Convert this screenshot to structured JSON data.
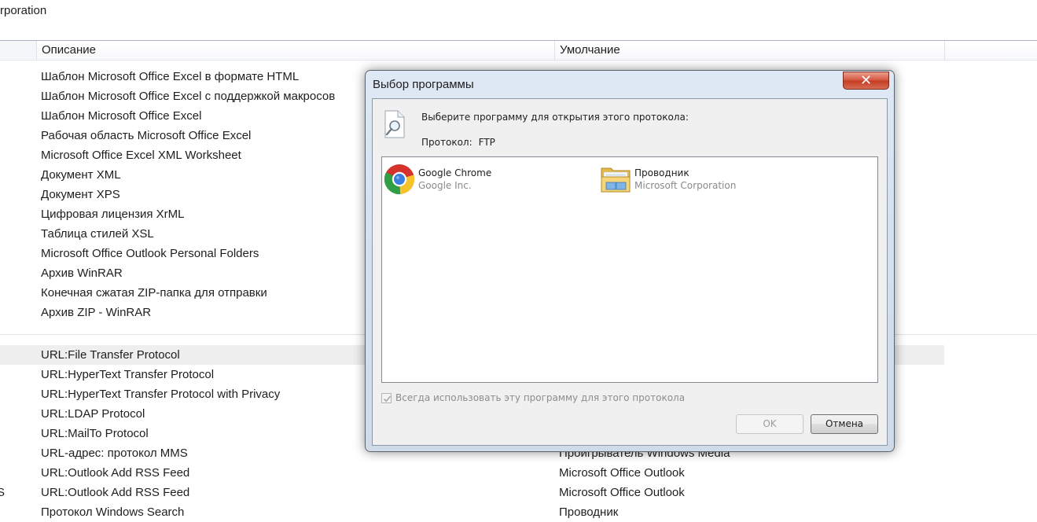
{
  "background": {
    "company_fragment": "rporation",
    "columns": [
      "Описание",
      "Умолчание"
    ],
    "rows_top": [
      {
        "description": "Шаблон Microsoft Office Excel в формате HTML",
        "default": ""
      },
      {
        "description": "Шаблон Microsoft Office Excel с поддержкой макросов",
        "default": ""
      },
      {
        "description": "Шаблон Microsoft Office Excel",
        "default": ""
      },
      {
        "description": "Рабочая область Microsoft Office Excel",
        "default": ""
      },
      {
        "description": "Microsoft Office Excel XML Worksheet",
        "default": ""
      },
      {
        "description": "Документ XML",
        "default": ""
      },
      {
        "description": "Документ XPS",
        "default": ""
      },
      {
        "description": "Цифровая лицензия XrML",
        "default": ""
      },
      {
        "description": "Таблица стилей XSL",
        "default": ""
      },
      {
        "description": "Microsoft Office Outlook Personal Folders",
        "default": ""
      },
      {
        "description": "Архив WinRAR",
        "default": ""
      },
      {
        "description": "Конечная сжатая ZIP-папка для отправки",
        "default": ""
      },
      {
        "description": "Архив ZIP - WinRAR",
        "default": ""
      }
    ],
    "rows_bottom": [
      {
        "description": "URL:File Transfer Protocol",
        "default": "",
        "selected": true,
        "edge": ""
      },
      {
        "description": "URL:HyperText Transfer Protocol",
        "default": "",
        "edge": ""
      },
      {
        "description": "URL:HyperText Transfer Protocol with Privacy",
        "default": "",
        "edge": ""
      },
      {
        "description": "URL:LDAP Protocol",
        "default": "",
        "edge": ""
      },
      {
        "description": "URL:MailTo Protocol",
        "default": "",
        "edge": ""
      },
      {
        "description": "URL-адрес: протокол MMS",
        "default": "Проигрыватель Windows Media",
        "edge": ""
      },
      {
        "description": "URL:Outlook Add RSS Feed",
        "default": "Microsoft Office Outlook",
        "edge": ""
      },
      {
        "description": "URL:Outlook Add RSS Feed",
        "default": "Microsoft Office Outlook",
        "edge": "S"
      },
      {
        "description": "Протокол Windows Search",
        "default": "Проводник",
        "edge": ""
      }
    ]
  },
  "dialog": {
    "title": "Выбор программы",
    "close_label": "✕",
    "prompt": "Выберите программу для открытия этого протокола:",
    "protocol_label": "Протокол:",
    "protocol_value": "FTP",
    "programs": [
      {
        "name": "Google Chrome",
        "vendor": "Google Inc.",
        "icon": "chrome-icon"
      },
      {
        "name": "Проводник",
        "vendor": "Microsoft Corporation",
        "icon": "folder-explorer-icon"
      }
    ],
    "always_use_label": "Всегда использовать эту программу для этого протокола",
    "always_use_checked": true,
    "always_use_disabled": true,
    "ok_label": "OK",
    "ok_disabled": true,
    "cancel_label": "Отмена"
  },
  "colors": {
    "dialog_frame": "#d4e1ef",
    "close_button": "#c43b22",
    "selected_row": "#eeeeee"
  }
}
